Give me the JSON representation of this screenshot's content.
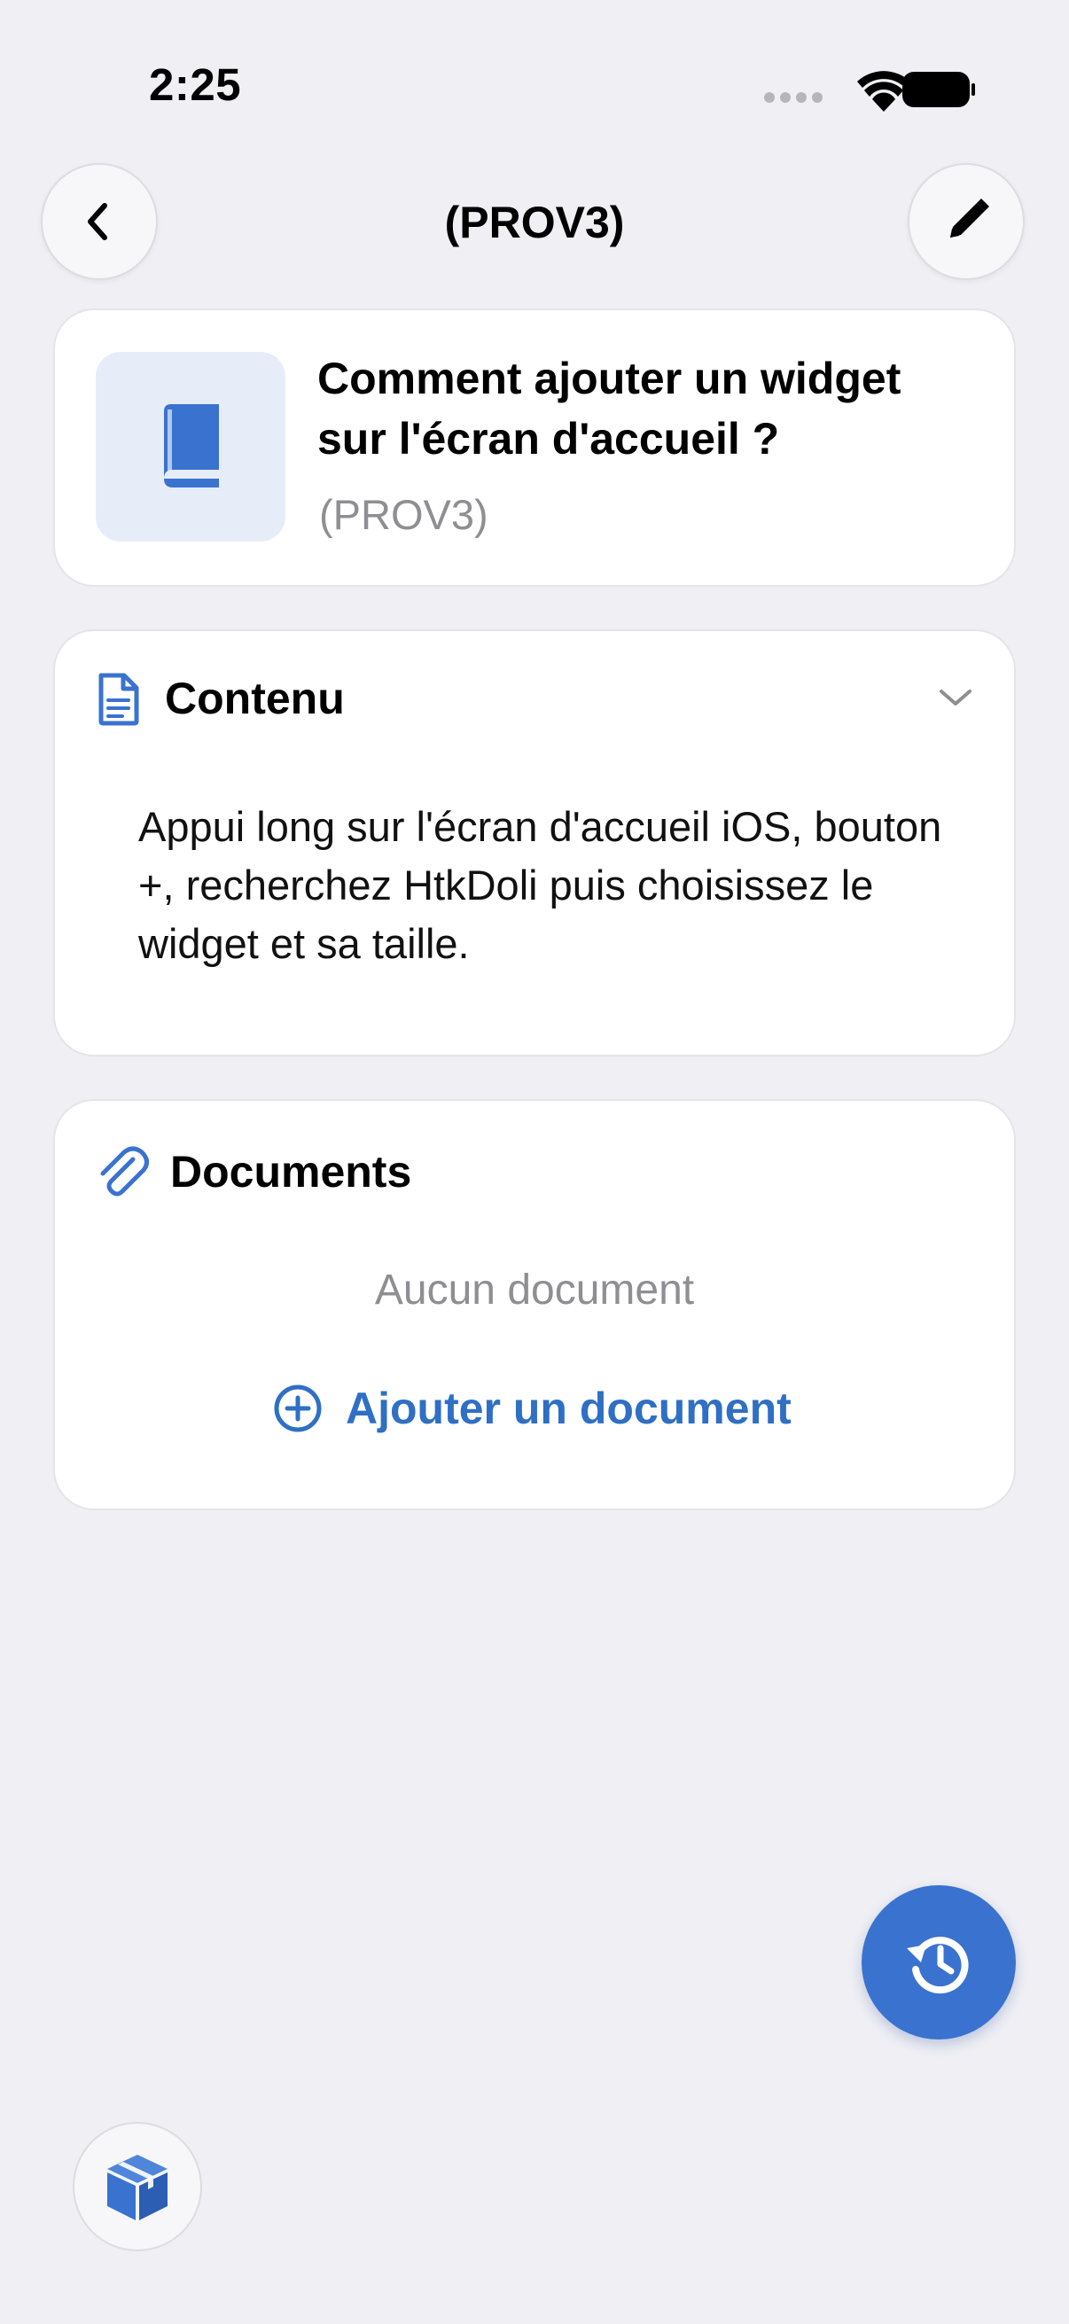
{
  "status_bar": {
    "time": "2:25"
  },
  "nav": {
    "title": "(PROV3)",
    "back_icon": "chevron-left-icon",
    "edit_icon": "pencil-icon"
  },
  "header_card": {
    "icon": "book-icon",
    "title": "Comment ajouter un widget sur l'écran d'accueil ?",
    "subtitle": "(PROV3)"
  },
  "content_card": {
    "icon": "document-icon",
    "title": "Contenu",
    "toggle_icon": "chevron-down-icon",
    "body": "Appui long sur l'écran d'accueil iOS, bouton +, recherchez HtkDoli puis choisissez le widget et sa taille."
  },
  "documents_card": {
    "icon": "paperclip-icon",
    "title": "Documents",
    "empty_text": "Aucun document",
    "add_label": "Ajouter un document",
    "add_icon": "plus-circle-icon"
  },
  "fab": {
    "icon": "history-icon"
  },
  "bottom_button": {
    "icon": "cube-icon"
  },
  "colors": {
    "background": "#efeff4",
    "accent": "#3a72cf",
    "link": "#2f6fc4",
    "secondary_text": "#8e8e93"
  }
}
